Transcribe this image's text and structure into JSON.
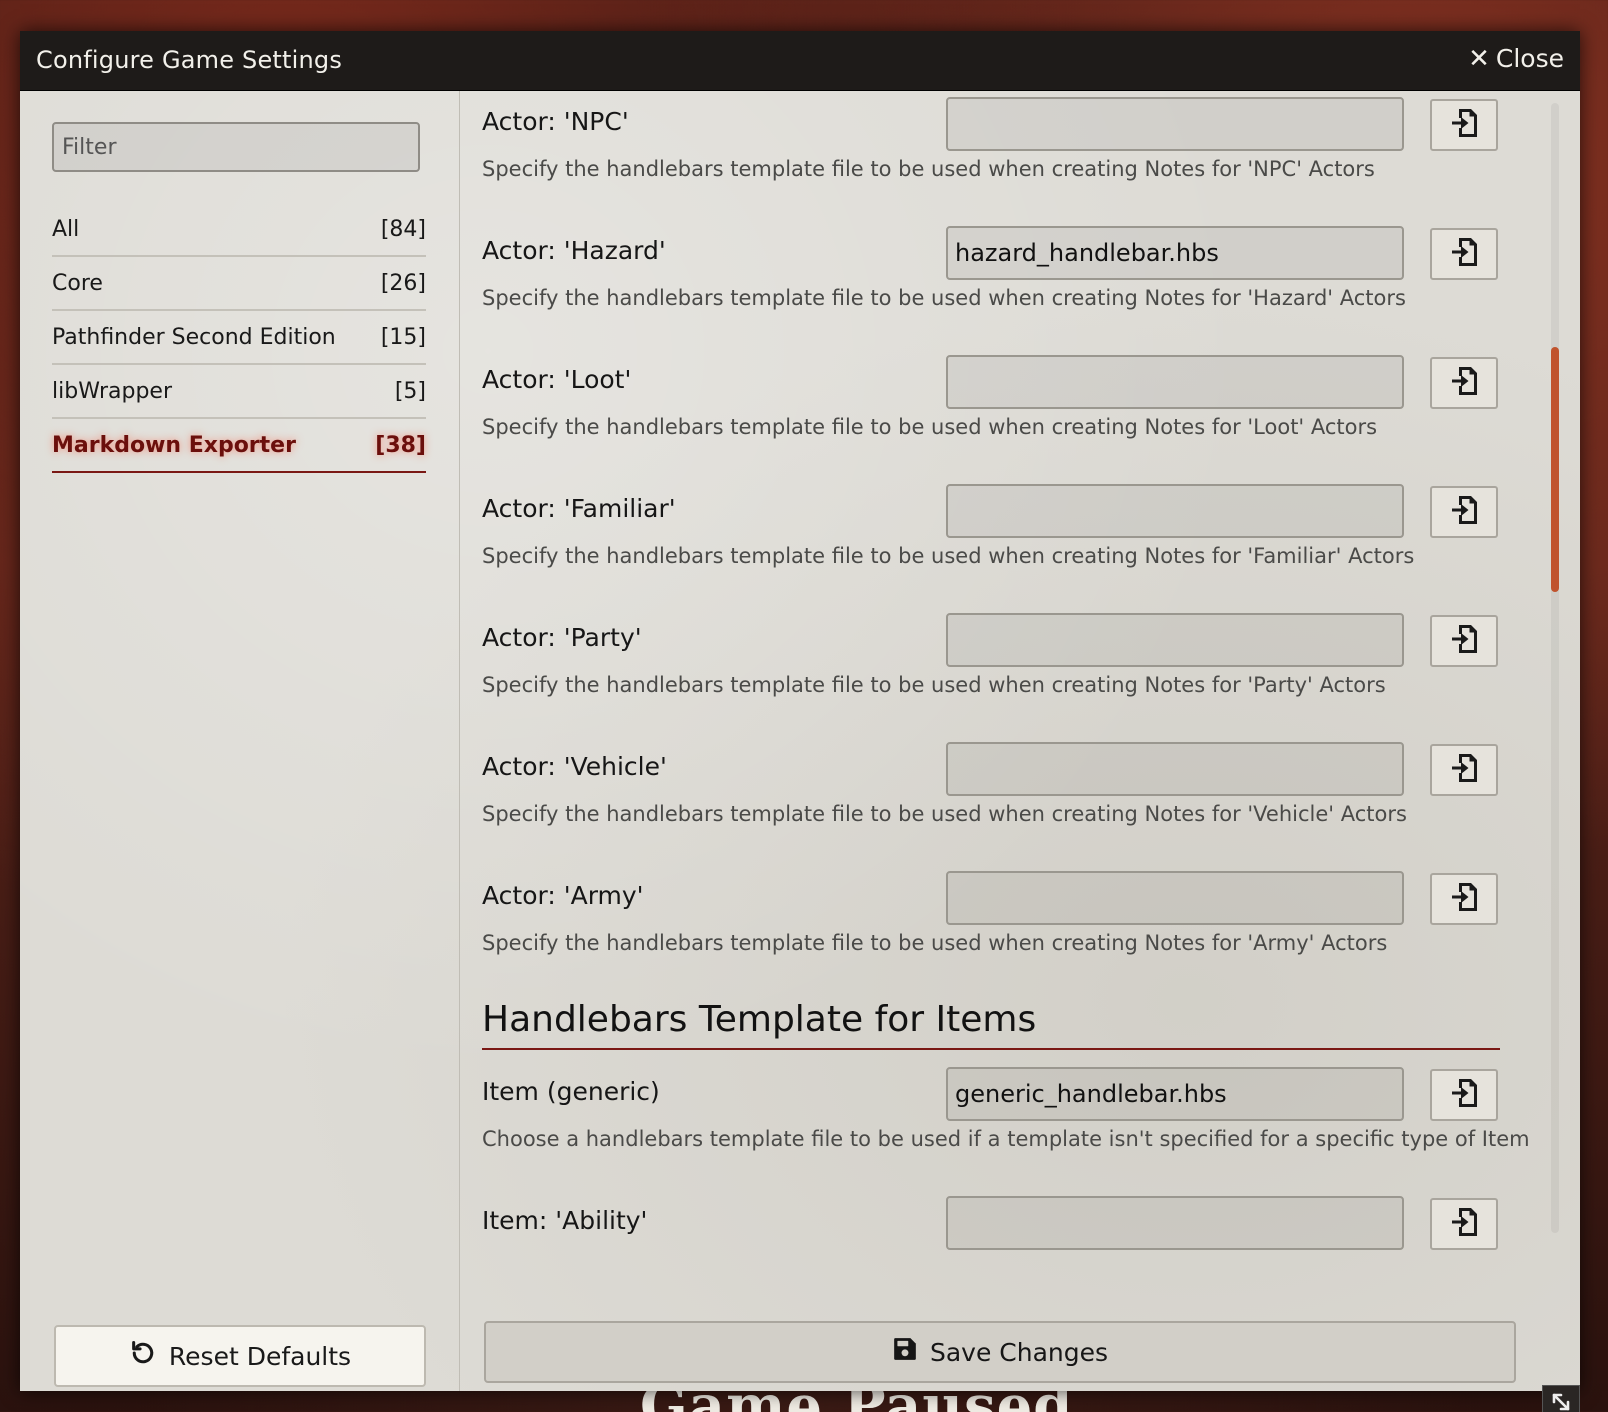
{
  "window": {
    "title": "Configure Game Settings",
    "close_label": "Close"
  },
  "background": {
    "paused_text": "Game Paused"
  },
  "sidebar": {
    "filter_placeholder": "Filter",
    "categories": [
      {
        "label": "All",
        "count": "[84]"
      },
      {
        "label": "Core",
        "count": "[26]"
      },
      {
        "label": "Pathfinder Second Edition",
        "count": "[15]"
      },
      {
        "label": "libWrapper",
        "count": "[5]"
      },
      {
        "label": "Markdown Exporter",
        "count": "[38]",
        "active": true
      }
    ],
    "reset_label": "Reset Defaults"
  },
  "settings": [
    {
      "label": "Actor: 'NPC'",
      "value": "",
      "hint": "Specify the handlebars template file to be used when creating Notes for 'NPC' Actors"
    },
    {
      "label": "Actor: 'Hazard'",
      "value": "hazard_handlebar.hbs",
      "hint": "Specify the handlebars template file to be used when creating Notes for 'Hazard' Actors"
    },
    {
      "label": "Actor: 'Loot'",
      "value": "",
      "hint": "Specify the handlebars template file to be used when creating Notes for 'Loot' Actors"
    },
    {
      "label": "Actor: 'Familiar'",
      "value": "",
      "hint": "Specify the handlebars template file to be used when creating Notes for 'Familiar' Actors"
    },
    {
      "label": "Actor: 'Party'",
      "value": "",
      "hint": "Specify the handlebars template file to be used when creating Notes for 'Party' Actors"
    },
    {
      "label": "Actor: 'Vehicle'",
      "value": "",
      "hint": "Specify the handlebars template file to be used when creating Notes for 'Vehicle' Actors"
    },
    {
      "label": "Actor: 'Army'",
      "value": "",
      "hint": "Specify the handlebars template file to be used when creating Notes for 'Army' Actors"
    }
  ],
  "items_section": {
    "title": "Handlebars Template for Items",
    "settings": [
      {
        "label": "Item (generic)",
        "value": "generic_handlebar.hbs",
        "hint": "Choose a handlebars template file to be used if a template isn't specified for a specific type of Item"
      },
      {
        "label": "Item: 'Ability'",
        "value": "",
        "hint": ""
      }
    ]
  },
  "footer": {
    "save_label": "Save Changes"
  },
  "icons": {
    "close": "close-icon",
    "file_picker": "file-import-icon",
    "reset": "undo-icon",
    "save": "floppy-disk-icon",
    "resize": "resize-icon"
  },
  "colors": {
    "header_bg": "#1e1b19",
    "active_category": "#6b0f0c",
    "accent_line": "#7a1814",
    "scrollbar": "#c0532d"
  }
}
